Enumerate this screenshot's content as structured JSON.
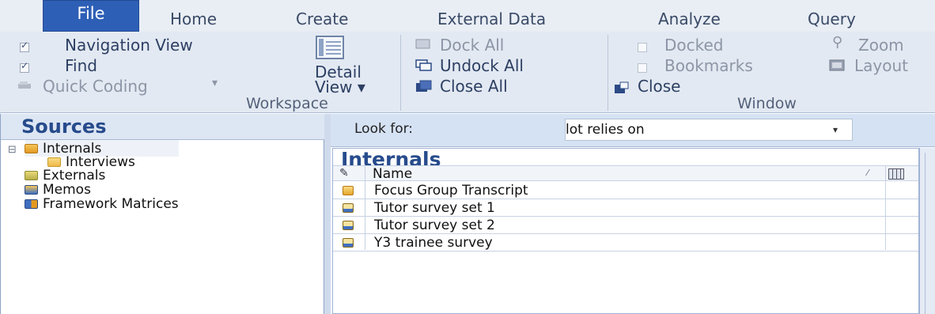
{
  "ribbon_tabs": {
    "file": "File",
    "home": "Home",
    "create": "Create",
    "external_data": "External Data",
    "analyze": "Analyze",
    "query": "Query"
  },
  "workspace": {
    "navigation_view": "Navigation View",
    "find": "Find",
    "quick_coding": "Quick Coding",
    "quick_coding_arrow": "▾",
    "detail_view_line1": "Detail",
    "detail_view_line2": "View ▾",
    "dock_all": "Dock All",
    "undock_all": "Undock All",
    "close_all": "Close All",
    "group_label": "Workspace"
  },
  "window": {
    "docked": "Docked",
    "bookmarks": "Bookmarks",
    "close": "Close",
    "zoom": "Zoom",
    "layout": "Layout",
    "group_label": "Window"
  },
  "sources": {
    "title": "Sources",
    "expander": "⊟",
    "items": [
      {
        "label": "Internals",
        "icon": "folder-open-icon"
      },
      {
        "label": "Interviews",
        "icon": "folder-open-icon"
      },
      {
        "label": "Externals",
        "icon": "folder-open-icon"
      },
      {
        "label": "Memos",
        "icon": "folder-icon"
      },
      {
        "label": "Framework Matrices",
        "icon": "matrix-folder-icon"
      }
    ]
  },
  "find_bar": {
    "look_for_label": "Look for:",
    "search_value": "lot relies on",
    "dropdown_arrow": "▾"
  },
  "list": {
    "title": "Internals",
    "column_name": "Name",
    "pin_icon": "pin-icon",
    "rows": [
      {
        "name": "Focus Group Transcript",
        "icon": "folder-document-icon"
      },
      {
        "name": "Tutor survey set 1",
        "icon": "dataset-icon"
      },
      {
        "name": "Tutor survey set 2",
        "icon": "dataset-icon"
      },
      {
        "name": "Y3 trainee survey",
        "icon": "dataset-icon"
      }
    ]
  },
  "colors": {
    "active_tab": "#2d5fb6",
    "title_blue": "#274b8c",
    "ribbon_bg": "#e3e9f2"
  }
}
